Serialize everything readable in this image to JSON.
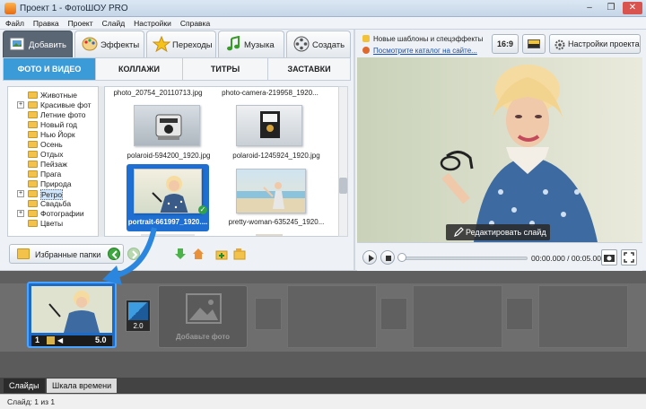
{
  "window": {
    "title": "Проект 1 - ФотоШОУ PRO",
    "controls": [
      "–",
      "❐",
      "✕"
    ]
  },
  "menu": [
    "Файл",
    "Правка",
    "Проект",
    "Слайд",
    "Настройки",
    "Справка"
  ],
  "tabs": [
    {
      "label": "Добавить",
      "icon": "photos-icon",
      "active": true
    },
    {
      "label": "Эффекты",
      "icon": "palette-icon"
    },
    {
      "label": "Переходы",
      "icon": "star-icon"
    },
    {
      "label": "Музыка",
      "icon": "music-note-icon"
    },
    {
      "label": "Создать",
      "icon": "film-reel-icon"
    }
  ],
  "subtabs": [
    {
      "label": "ФОТО И ВИДЕО",
      "active": true
    },
    {
      "label": "КОЛЛАЖИ"
    },
    {
      "label": "ТИТРЫ"
    },
    {
      "label": "ЗАСТАВКИ"
    }
  ],
  "tree": [
    {
      "label": "Животные"
    },
    {
      "label": "Красивые фот",
      "plus": true
    },
    {
      "label": "Летние фото"
    },
    {
      "label": "Новый год"
    },
    {
      "label": "Нью Йорк"
    },
    {
      "label": "Осень"
    },
    {
      "label": "Отдых"
    },
    {
      "label": "Пейзаж"
    },
    {
      "label": "Прага"
    },
    {
      "label": "Природа"
    },
    {
      "label": "Ретро",
      "plus": true,
      "selected": true
    },
    {
      "label": "Свадьба"
    },
    {
      "label": "Фотографии",
      "plus": true
    },
    {
      "label": "Цветы"
    }
  ],
  "files": {
    "top_row": [
      "photo_20754_20110713.jpg",
      "photo-camera-219958_1920..."
    ],
    "items": [
      {
        "caption": "polaroid-594200_1920.jpg",
        "scene": "camera"
      },
      {
        "caption": "polaroid-1245924_1920.jpg",
        "scene": "camera2"
      },
      {
        "caption": "portrait-661997_1920....",
        "scene": "woman",
        "selected": true
      },
      {
        "caption": "pretty-woman-635245_1920...",
        "scene": "beach"
      }
    ]
  },
  "favorites_label": "Избранные папки",
  "right": {
    "note": "Новые шаблоны и спецэффекты",
    "link": "Посмотрите каталог на сайте...",
    "ratio": "16:9",
    "settings_label": "Настройки проекта",
    "edit_slide": "Редактировать слайд",
    "time": "00:00.000 / 00:05.000"
  },
  "timeline": {
    "slide": {
      "number": "1",
      "duration": "5.0"
    },
    "transition_duration": "2.0",
    "add_photo": "Добавьте фото"
  },
  "bottom_tabs": [
    {
      "label": "Слайды",
      "active": true
    },
    {
      "label": "Шкала времени"
    }
  ],
  "status": "Слайд: 1 из 1"
}
